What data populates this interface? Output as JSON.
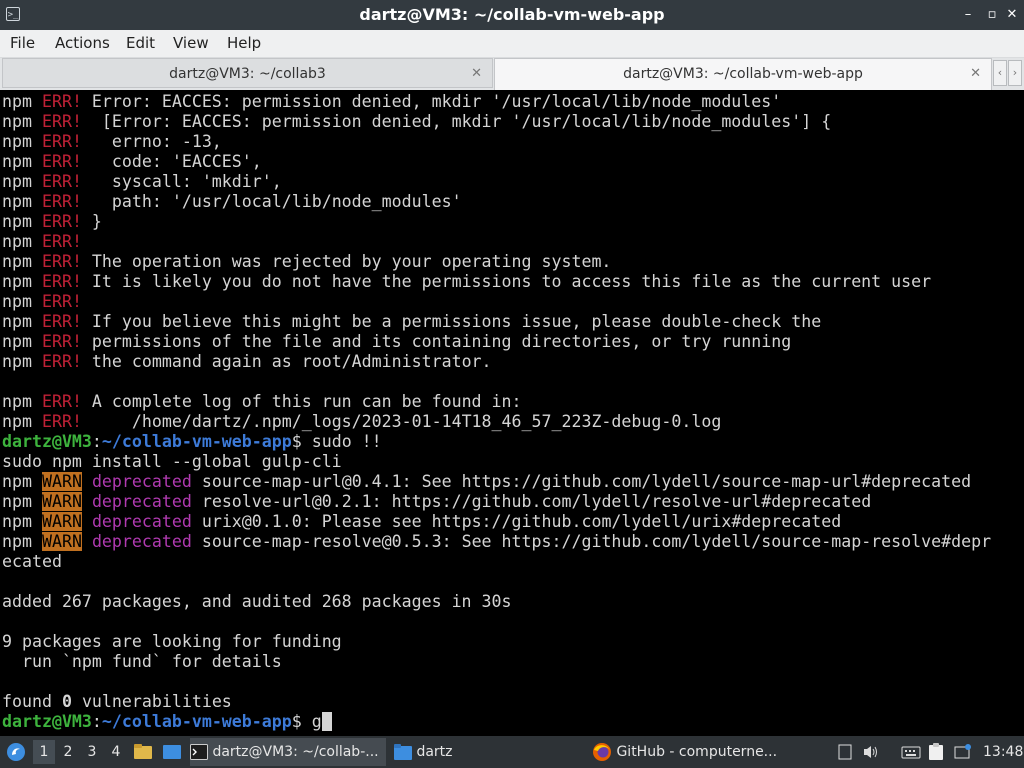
{
  "window": {
    "title": "dartz@VM3: ~/collab-vm-web-app",
    "controls": {
      "minimize": "–",
      "maximize": "▫",
      "close": "✕"
    }
  },
  "menu": [
    "File",
    "Actions",
    "Edit",
    "View",
    "Help"
  ],
  "tabs": [
    {
      "label": "dartz@VM3: ~/collab3",
      "active": false
    },
    {
      "label": "dartz@VM3: ~/collab-vm-web-app",
      "active": true
    }
  ],
  "terminal": {
    "lines": [
      [
        [
          "npm ",
          ""
        ],
        [
          "ERR!",
          "red"
        ],
        [
          " Error: EACCES: permission denied, mkdir '/usr/local/lib/node_modules'",
          ""
        ]
      ],
      [
        [
          "npm ",
          ""
        ],
        [
          "ERR!",
          "red"
        ],
        [
          "  [Error: EACCES: permission denied, mkdir '/usr/local/lib/node_modules'] {",
          ""
        ]
      ],
      [
        [
          "npm ",
          ""
        ],
        [
          "ERR!",
          "red"
        ],
        [
          "   errno: -13,",
          ""
        ]
      ],
      [
        [
          "npm ",
          ""
        ],
        [
          "ERR!",
          "red"
        ],
        [
          "   code: 'EACCES',",
          ""
        ]
      ],
      [
        [
          "npm ",
          ""
        ],
        [
          "ERR!",
          "red"
        ],
        [
          "   syscall: 'mkdir',",
          ""
        ]
      ],
      [
        [
          "npm ",
          ""
        ],
        [
          "ERR!",
          "red"
        ],
        [
          "   path: '/usr/local/lib/node_modules'",
          ""
        ]
      ],
      [
        [
          "npm ",
          ""
        ],
        [
          "ERR!",
          "red"
        ],
        [
          " }",
          ""
        ]
      ],
      [
        [
          "npm ",
          ""
        ],
        [
          "ERR!",
          "red"
        ]
      ],
      [
        [
          "npm ",
          ""
        ],
        [
          "ERR!",
          "red"
        ],
        [
          " The operation was rejected by your operating system.",
          ""
        ]
      ],
      [
        [
          "npm ",
          ""
        ],
        [
          "ERR!",
          "red"
        ],
        [
          " It is likely you do not have the permissions to access this file as the current user",
          ""
        ]
      ],
      [
        [
          "npm ",
          ""
        ],
        [
          "ERR!",
          "red"
        ]
      ],
      [
        [
          "npm ",
          ""
        ],
        [
          "ERR!",
          "red"
        ],
        [
          " If you believe this might be a permissions issue, please double-check the",
          ""
        ]
      ],
      [
        [
          "npm ",
          ""
        ],
        [
          "ERR!",
          "red"
        ],
        [
          " permissions of the file and its containing directories, or try running",
          ""
        ]
      ],
      [
        [
          "npm ",
          ""
        ],
        [
          "ERR!",
          "red"
        ],
        [
          " the command again as root/Administrator.",
          ""
        ]
      ],
      [],
      [
        [
          "npm ",
          ""
        ],
        [
          "ERR!",
          "red"
        ],
        [
          " A complete log of this run can be found in:",
          ""
        ]
      ],
      [
        [
          "npm ",
          ""
        ],
        [
          "ERR!",
          "red"
        ],
        [
          "     /home/dartz/.npm/_logs/2023-01-14T18_46_57_223Z-debug-0.log",
          ""
        ]
      ],
      [
        [
          "dartz@VM3",
          "pg"
        ],
        [
          ":",
          ""
        ],
        [
          "~/collab-vm-web-app",
          "pb"
        ],
        [
          "$ sudo !!",
          ""
        ]
      ],
      [
        [
          "sudo npm install --global gulp-cli",
          ""
        ]
      ],
      [
        [
          "npm ",
          ""
        ],
        [
          "WARN",
          "warn"
        ],
        [
          " ",
          ""
        ],
        [
          "deprecated",
          "mag"
        ],
        [
          " source-map-url@0.4.1: See https://github.com/lydell/source-map-url#deprecated",
          ""
        ]
      ],
      [
        [
          "npm ",
          ""
        ],
        [
          "WARN",
          "warn"
        ],
        [
          " ",
          ""
        ],
        [
          "deprecated",
          "mag"
        ],
        [
          " resolve-url@0.2.1: https://github.com/lydell/resolve-url#deprecated",
          ""
        ]
      ],
      [
        [
          "npm ",
          ""
        ],
        [
          "WARN",
          "warn"
        ],
        [
          " ",
          ""
        ],
        [
          "deprecated",
          "mag"
        ],
        [
          " urix@0.1.0: Please see https://github.com/lydell/urix#deprecated",
          ""
        ]
      ],
      [
        [
          "npm ",
          ""
        ],
        [
          "WARN",
          "warn"
        ],
        [
          " ",
          ""
        ],
        [
          "deprecated",
          "mag"
        ],
        [
          " source-map-resolve@0.5.3: See https://github.com/lydell/source-map-resolve#depr",
          ""
        ]
      ],
      [
        [
          "ecated",
          ""
        ]
      ],
      [],
      [
        [
          "added 267 packages, and audited 268 packages in 30s",
          ""
        ]
      ],
      [],
      [
        [
          "9 packages are looking for funding",
          ""
        ]
      ],
      [
        [
          "  run `npm fund` for details",
          ""
        ]
      ],
      [],
      [
        [
          "found ",
          ""
        ],
        [
          "0",
          "bold"
        ],
        [
          " vulnerabilities",
          ""
        ]
      ],
      [
        [
          "dartz@VM3",
          "pg"
        ],
        [
          ":",
          ""
        ],
        [
          "~/collab-vm-web-app",
          "pb"
        ],
        [
          "$ g",
          ""
        ],
        [
          " ",
          "cursor"
        ]
      ]
    ]
  },
  "taskbar": {
    "workspaces": [
      "1",
      "2",
      "3",
      "4"
    ],
    "tasks": [
      {
        "label": "dartz@VM3: ~/collab-...",
        "icon": "terminal-icon",
        "active": true
      },
      {
        "label": "dartz",
        "icon": "folder-icon",
        "active": false
      },
      {
        "label": "GitHub - computerne...",
        "icon": "firefox-icon",
        "active": false
      }
    ],
    "clock": "13:48"
  }
}
